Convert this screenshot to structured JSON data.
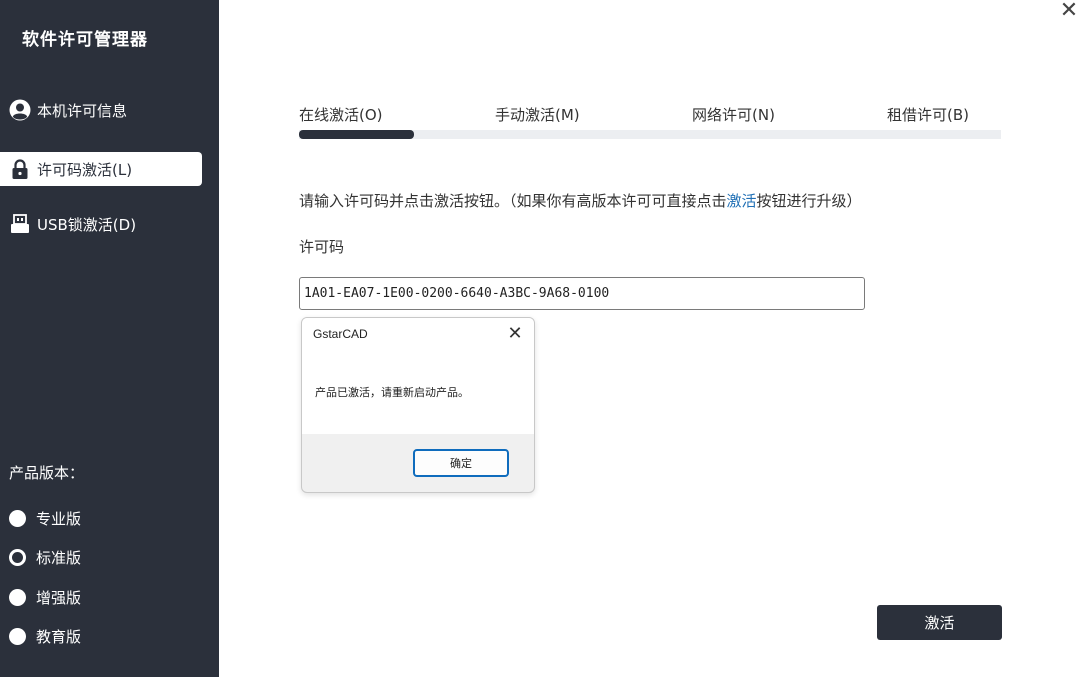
{
  "sidebar": {
    "title": "软件许可管理器",
    "nav_items": [
      {
        "label": "本机许可信息",
        "icon": "user-icon",
        "active": false
      },
      {
        "label": "许可码激活(L)",
        "icon": "lock-icon",
        "active": true
      },
      {
        "label": "USB锁激活(D)",
        "icon": "usb-drive-icon",
        "active": false
      }
    ],
    "version_label": "产品版本：",
    "versions": [
      {
        "label": "专业版",
        "selected": false
      },
      {
        "label": "标准版",
        "selected": true
      },
      {
        "label": "增强版",
        "selected": false
      },
      {
        "label": "教育版",
        "selected": false
      }
    ]
  },
  "window": {
    "close_icon": "close-icon",
    "close_glyph": "✕"
  },
  "tabs": [
    {
      "label": "在线激活(O)",
      "active": true
    },
    {
      "label": "手动激活(M)",
      "active": false
    },
    {
      "label": "网络许可(N)",
      "active": false
    },
    {
      "label": "租借许可(B)",
      "active": false
    }
  ],
  "main": {
    "instruction_before": "请输入许可码并点击激活按钮。（如果你有高版本许可可直接点击",
    "instruction_link": "激活",
    "instruction_after": "按钮进行升级）",
    "field_label": "许可码",
    "license_code": "1A01-EA07-1E00-0200-6640-A3BC-9A68-0100",
    "activate_label": "激活"
  },
  "dialog": {
    "title": "GstarCAD",
    "close_glyph": "✕",
    "message": "产品已激活，请重新启动产品。",
    "ok_label": "确定"
  },
  "colors": {
    "sidebar_bg": "#2b303b",
    "link": "#1f6fb5",
    "dialog_ok_border": "#0f6cbd"
  }
}
